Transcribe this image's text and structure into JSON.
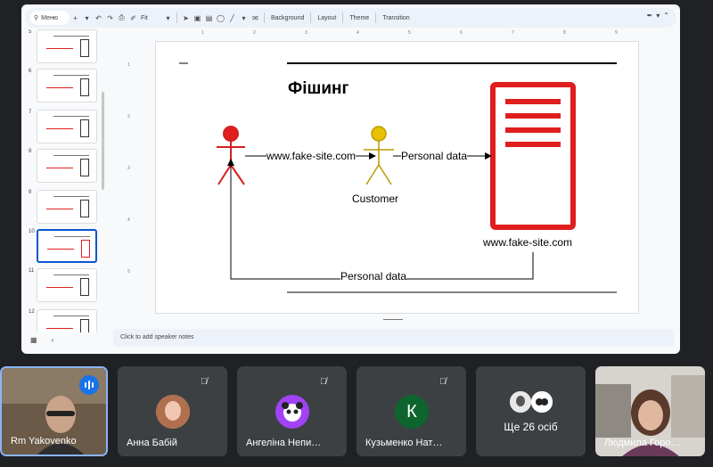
{
  "toolbar": {
    "menus_label": "Меню",
    "zoom_label": "Fit",
    "background_label": "Background",
    "layout_label": "Layout",
    "theme_label": "Theme",
    "transition_label": "Transition"
  },
  "filmstrip": {
    "slides": [
      {
        "number": "5",
        "selected": false
      },
      {
        "number": "6",
        "selected": false
      },
      {
        "number": "7",
        "selected": false
      },
      {
        "number": "8",
        "selected": false
      },
      {
        "number": "9",
        "selected": false
      },
      {
        "number": "10",
        "selected": true
      },
      {
        "number": "11",
        "selected": false
      },
      {
        "number": "12",
        "selected": false
      }
    ]
  },
  "slide": {
    "title": "Фішинг",
    "arrow1_label": "www.fake-site.com",
    "arrow2_label": "Personal data",
    "customer_label": "Customer",
    "server_label": "www.fake-site.com",
    "return_label": "Personal data"
  },
  "notes": {
    "placeholder": "Click to add speaker notes"
  },
  "ruler": {
    "top_ticks": [
      "1",
      "2",
      "3",
      "4",
      "5",
      "6",
      "7",
      "8",
      "9"
    ],
    "left_ticks": [
      "1",
      "2",
      "3",
      "4",
      "5"
    ]
  },
  "participants": [
    {
      "name": "Rm Yakovenko",
      "speaking": true
    },
    {
      "name": "Анна Бабій",
      "speaking": false
    },
    {
      "name": "Ангеліна Непи…",
      "speaking": false
    },
    {
      "name": "Кузьменко Нат…",
      "speaking": false,
      "initial": "К"
    },
    {
      "name": "Людмила Горо…",
      "speaking": false
    }
  ],
  "more_participants": "Ще 26 осіб",
  "colors": {
    "accent": "#0b57d0",
    "attacker": "#e01e1e",
    "customer": "#c8a800",
    "server": "#e01e1e",
    "avatar_purple": "#a142f4",
    "avatar_green": "#0d652d"
  }
}
